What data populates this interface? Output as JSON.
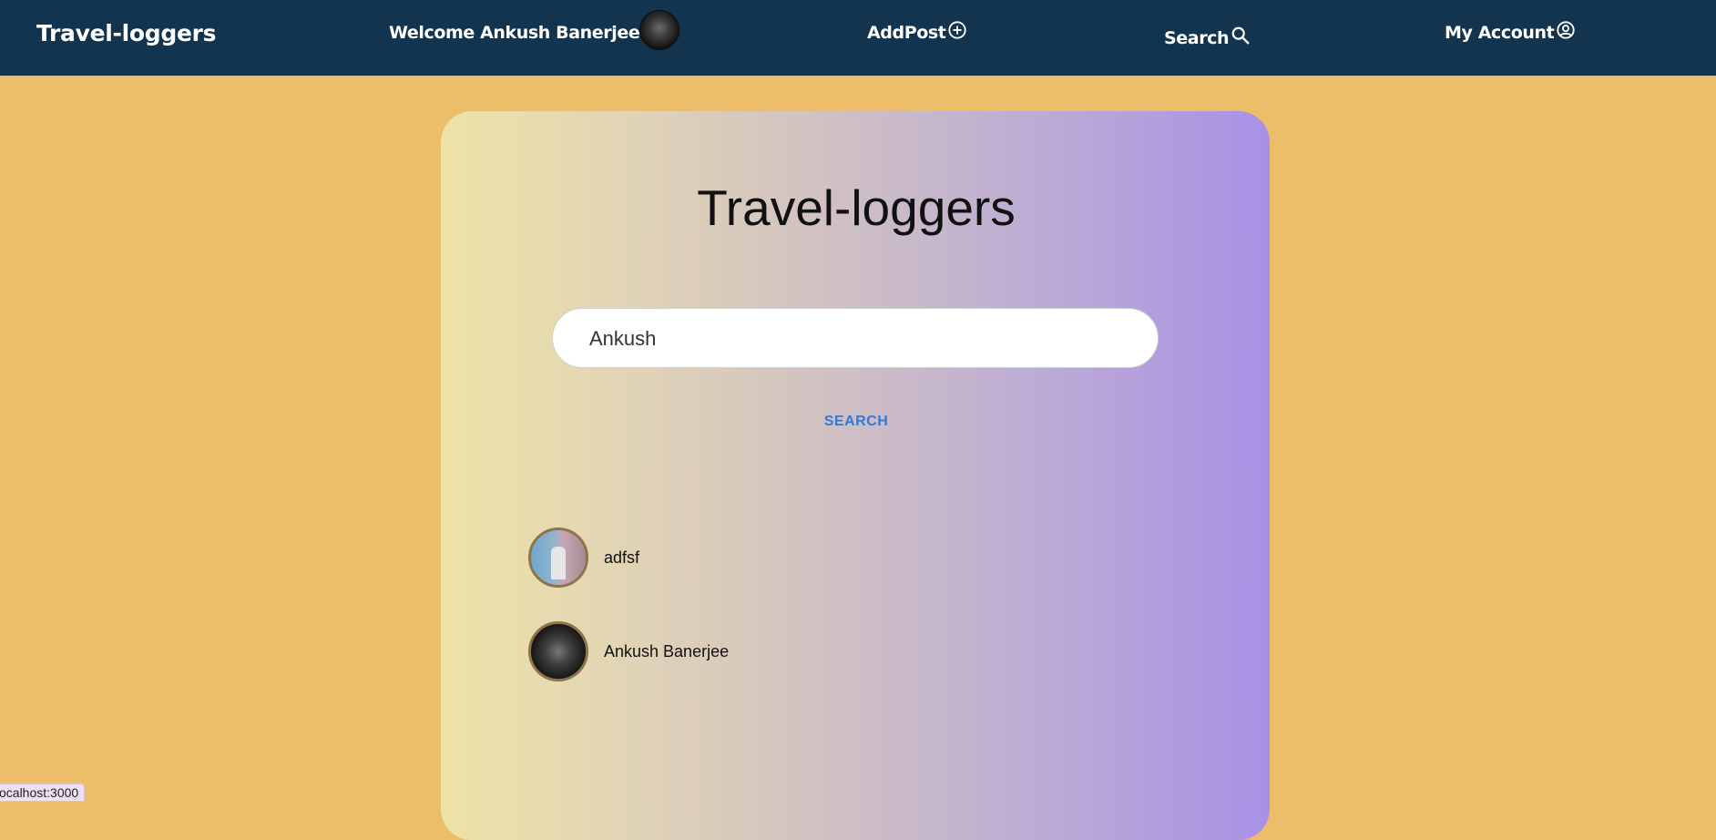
{
  "nav": {
    "brand": "Travel-loggers",
    "welcome": "Welcome Ankush Banerjee",
    "add_post": "AddPost",
    "search": "Search",
    "account": "My Account",
    "icons": {
      "avatar": "user-avatar",
      "add": "plus-circle-icon",
      "search": "search-icon",
      "account": "user-circle-icon"
    }
  },
  "main": {
    "title": "Travel-loggers",
    "search_value": "Ankush",
    "search_button": "SEARCH",
    "results": [
      {
        "name": "adfsf"
      },
      {
        "name": "Ankush Banerjee"
      }
    ]
  },
  "status_bar": "ocalhost:3000",
  "colors": {
    "page_bg": "#ECBE6A",
    "navbar": "#12344E",
    "accent_link": "#2F7BD9",
    "gradient_start": "#EEE3A6",
    "gradient_end": "#A990E5"
  }
}
